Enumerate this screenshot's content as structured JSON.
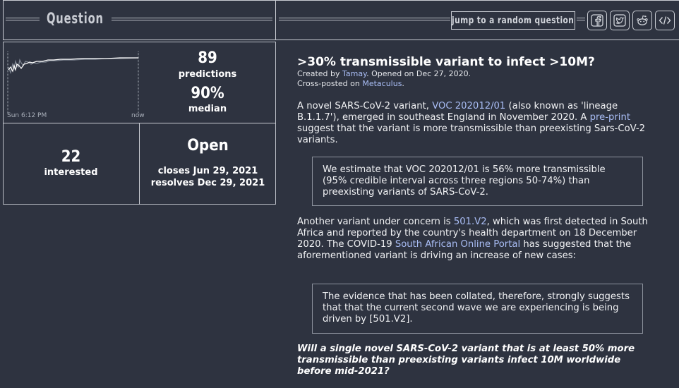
{
  "header": {
    "title": "Question",
    "random_button": "jump to a random question",
    "social": [
      {
        "name": "facebook-icon"
      },
      {
        "name": "twitter-icon"
      },
      {
        "name": "reddit-icon"
      },
      {
        "name": "embed-code-icon"
      }
    ]
  },
  "stats": {
    "chart": {
      "start_label": "Sun 6:12 PM",
      "end_label": "now"
    },
    "predictions_count": "89",
    "predictions_label": "predictions",
    "median_value": "90%",
    "median_label": "median",
    "interested_count": "22",
    "interested_label": "interested",
    "status": "Open",
    "closes": "closes Jun 29, 2021",
    "resolves": "resolves Dec 29, 2021"
  },
  "question": {
    "title": ">30% transmissible variant to infect >10M?",
    "created_prefix": "Created by ",
    "author": "Tamay",
    "opened": ". Opened on Dec 27, 2020.",
    "crosspost_prefix": "Cross-posted on ",
    "crosspost_site": "Metaculus",
    "crosspost_suffix": ".",
    "p1_a": "A novel SARS-CoV-2 variant, ",
    "p1_link1": "VOC 202012/01",
    "p1_b": " (also known as 'lineage B.1.1.7'), emerged in southeast England in November 2020. A ",
    "p1_link2": "pre-print",
    "p1_c": " suggest that the variant is more transmissible than preexisting Sars-CoV-2 variants.",
    "quote1": "We estimate that VOC 202012/01 is 56% more transmissible (95% credible interval across three regions 50-74%) than preexisting variants of SARS-CoV-2.",
    "p2_a": "Another variant under concern is ",
    "p2_link1": "501.V2",
    "p2_b": ", which was first detected in South Africa and reported by the country's health department on 18 December 2020. The COVID-19 ",
    "p2_link2": "South African Online Portal",
    "p2_c": " has suggested that the aforementioned variant is driving an increase of new cases:",
    "quote2": "The evidence that has been collated, therefore, strongly suggests that that the current second wave we are experiencing is being driven by [501.V2].",
    "final": "Will a single novel SARS-CoV-2 variant that is at least 50% more transmissible than preexisting variants infect 10M worldwide before mid-2021?"
  },
  "colors": {
    "background": "#2e3340",
    "link": "#a9bdf5",
    "line": "#c9ccd3"
  }
}
